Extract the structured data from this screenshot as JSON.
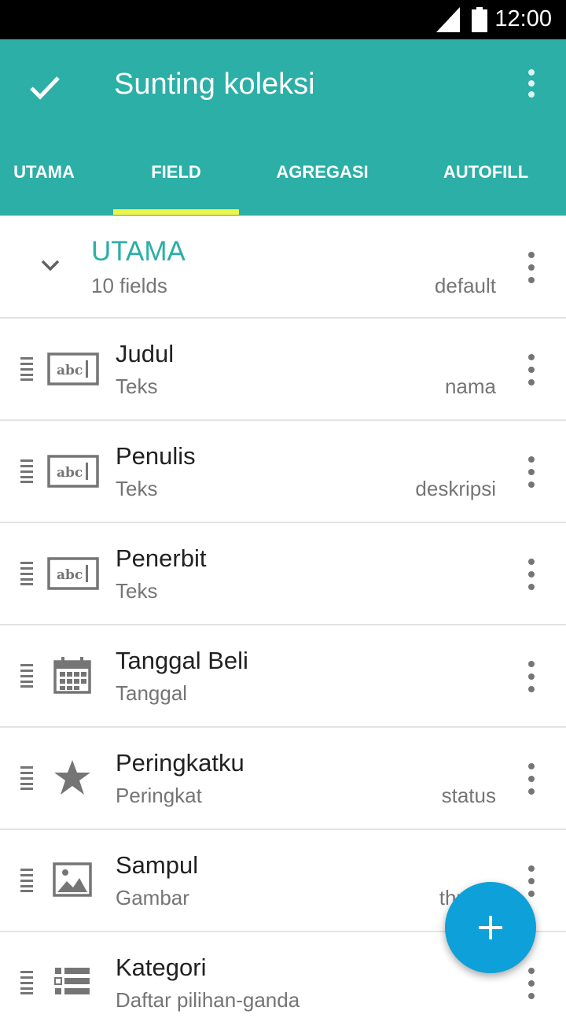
{
  "status_bar": {
    "time": "12:00"
  },
  "app_bar": {
    "title": "Sunting koleksi"
  },
  "tabs": [
    {
      "label": "UTAMA"
    },
    {
      "label": "FIELD"
    },
    {
      "label": "AGREGASI"
    },
    {
      "label": "AUTOFILL"
    }
  ],
  "selected_tab": "FIELD",
  "group": {
    "title": "UTAMA",
    "count": "10 fields",
    "badge": "default"
  },
  "fields": [
    {
      "title": "Judul",
      "type": "Teks",
      "role": "nama",
      "icon": "text-field-icon"
    },
    {
      "title": "Penulis",
      "type": "Teks",
      "role": "deskripsi",
      "icon": "text-field-icon"
    },
    {
      "title": "Penerbit",
      "type": "Teks",
      "role": "",
      "icon": "text-field-icon"
    },
    {
      "title": "Tanggal Beli",
      "type": "Tanggal",
      "role": "",
      "icon": "calendar-icon"
    },
    {
      "title": "Peringkatku",
      "type": "Peringkat",
      "role": "status",
      "icon": "star-icon"
    },
    {
      "title": "Sampul",
      "type": "Gambar",
      "role": "thumb",
      "icon": "image-icon"
    },
    {
      "title": "Kategori",
      "type": "Daftar pilihan-ganda",
      "role": "",
      "icon": "list-icon"
    }
  ],
  "fab": {
    "icon": "plus-icon"
  },
  "colors": {
    "primary": "#2bafa6",
    "accent_indicator": "#eef54a",
    "fab": "#0ea0d8"
  }
}
